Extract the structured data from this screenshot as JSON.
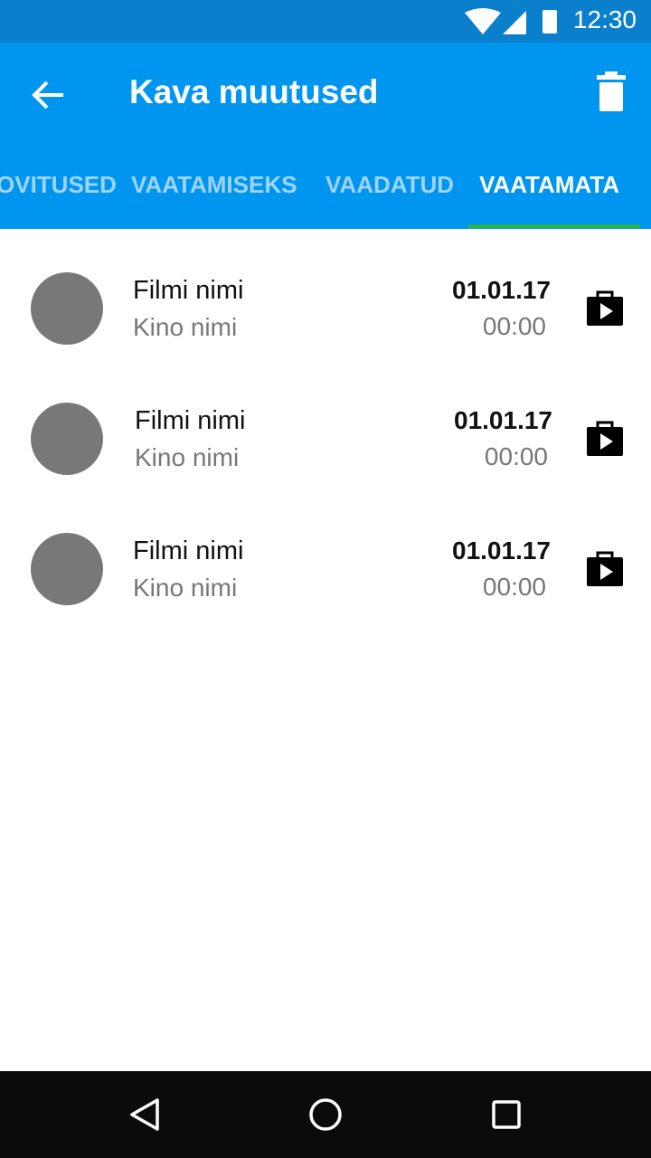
{
  "status_bar": {
    "time": "12:30",
    "icons": [
      "wifi-icon",
      "signal-icon",
      "battery-icon"
    ]
  },
  "app_bar": {
    "title": "Kava muutused",
    "back_icon": "arrow-left-icon",
    "action_icon": "trash-icon",
    "tabs": [
      {
        "label": "OVITUSED",
        "active": false
      },
      {
        "label": "VAATAMISEKS",
        "active": false
      },
      {
        "label": "VAADATUD",
        "active": false
      },
      {
        "label": "VAATAMATA",
        "active": true
      }
    ],
    "color": "#0096f0",
    "indicator_color": "#27b54c"
  },
  "items": [
    {
      "film": "Filmi nimi",
      "cinema": "Kino nimi",
      "date": "01.01.17",
      "time": "00:00",
      "icon": "play-store-bag-icon"
    },
    {
      "film": "Filmi nimi",
      "cinema": "Kino nimi",
      "date": "01.01.17",
      "time": "00:00",
      "icon": "play-store-bag-icon"
    },
    {
      "film": "Filmi nimi",
      "cinema": "Kino nimi",
      "date": "01.01.17",
      "time": "00:00",
      "icon": "play-store-bag-icon"
    }
  ],
  "nav_bar": {
    "icons": [
      "back-triangle-icon",
      "home-circle-icon",
      "recents-square-icon"
    ]
  }
}
